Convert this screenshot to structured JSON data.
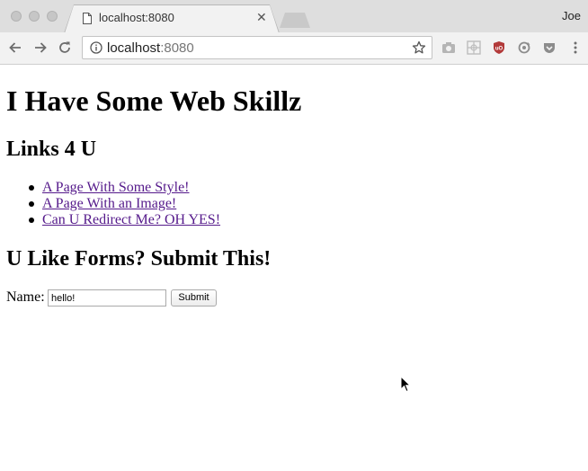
{
  "window": {
    "profile_name": "Joe"
  },
  "tab": {
    "title": "localhost:8080",
    "close_icon": "close-icon",
    "favicon": "document-icon"
  },
  "toolbar": {
    "back_icon": "back-arrow-icon",
    "forward_icon": "forward-arrow-icon",
    "reload_icon": "reload-icon",
    "url_host": "localhost",
    "url_port": ":8080",
    "extensions": [
      "camera-icon",
      "grid-icon",
      "ublock-shield-icon",
      "sync-icon",
      "pocket-icon",
      "menu-dots-icon"
    ]
  },
  "page": {
    "heading": "I Have Some Web Skillz",
    "links_heading": "Links 4 U",
    "links": [
      {
        "label": "A Page With Some Style!"
      },
      {
        "label": "A Page With an Image!"
      },
      {
        "label": "Can U Redirect Me? OH YES!"
      }
    ],
    "forms_heading": "U Like Forms? Submit This!",
    "form": {
      "name_label": "Name:",
      "name_value": "hello!",
      "submit_label": "Submit"
    }
  },
  "colors": {
    "visited_link": "#551a8b",
    "chrome_bg": "#f2f2f2",
    "tabstrip_bg": "#dedede",
    "ublock_red": "#c0392b"
  }
}
